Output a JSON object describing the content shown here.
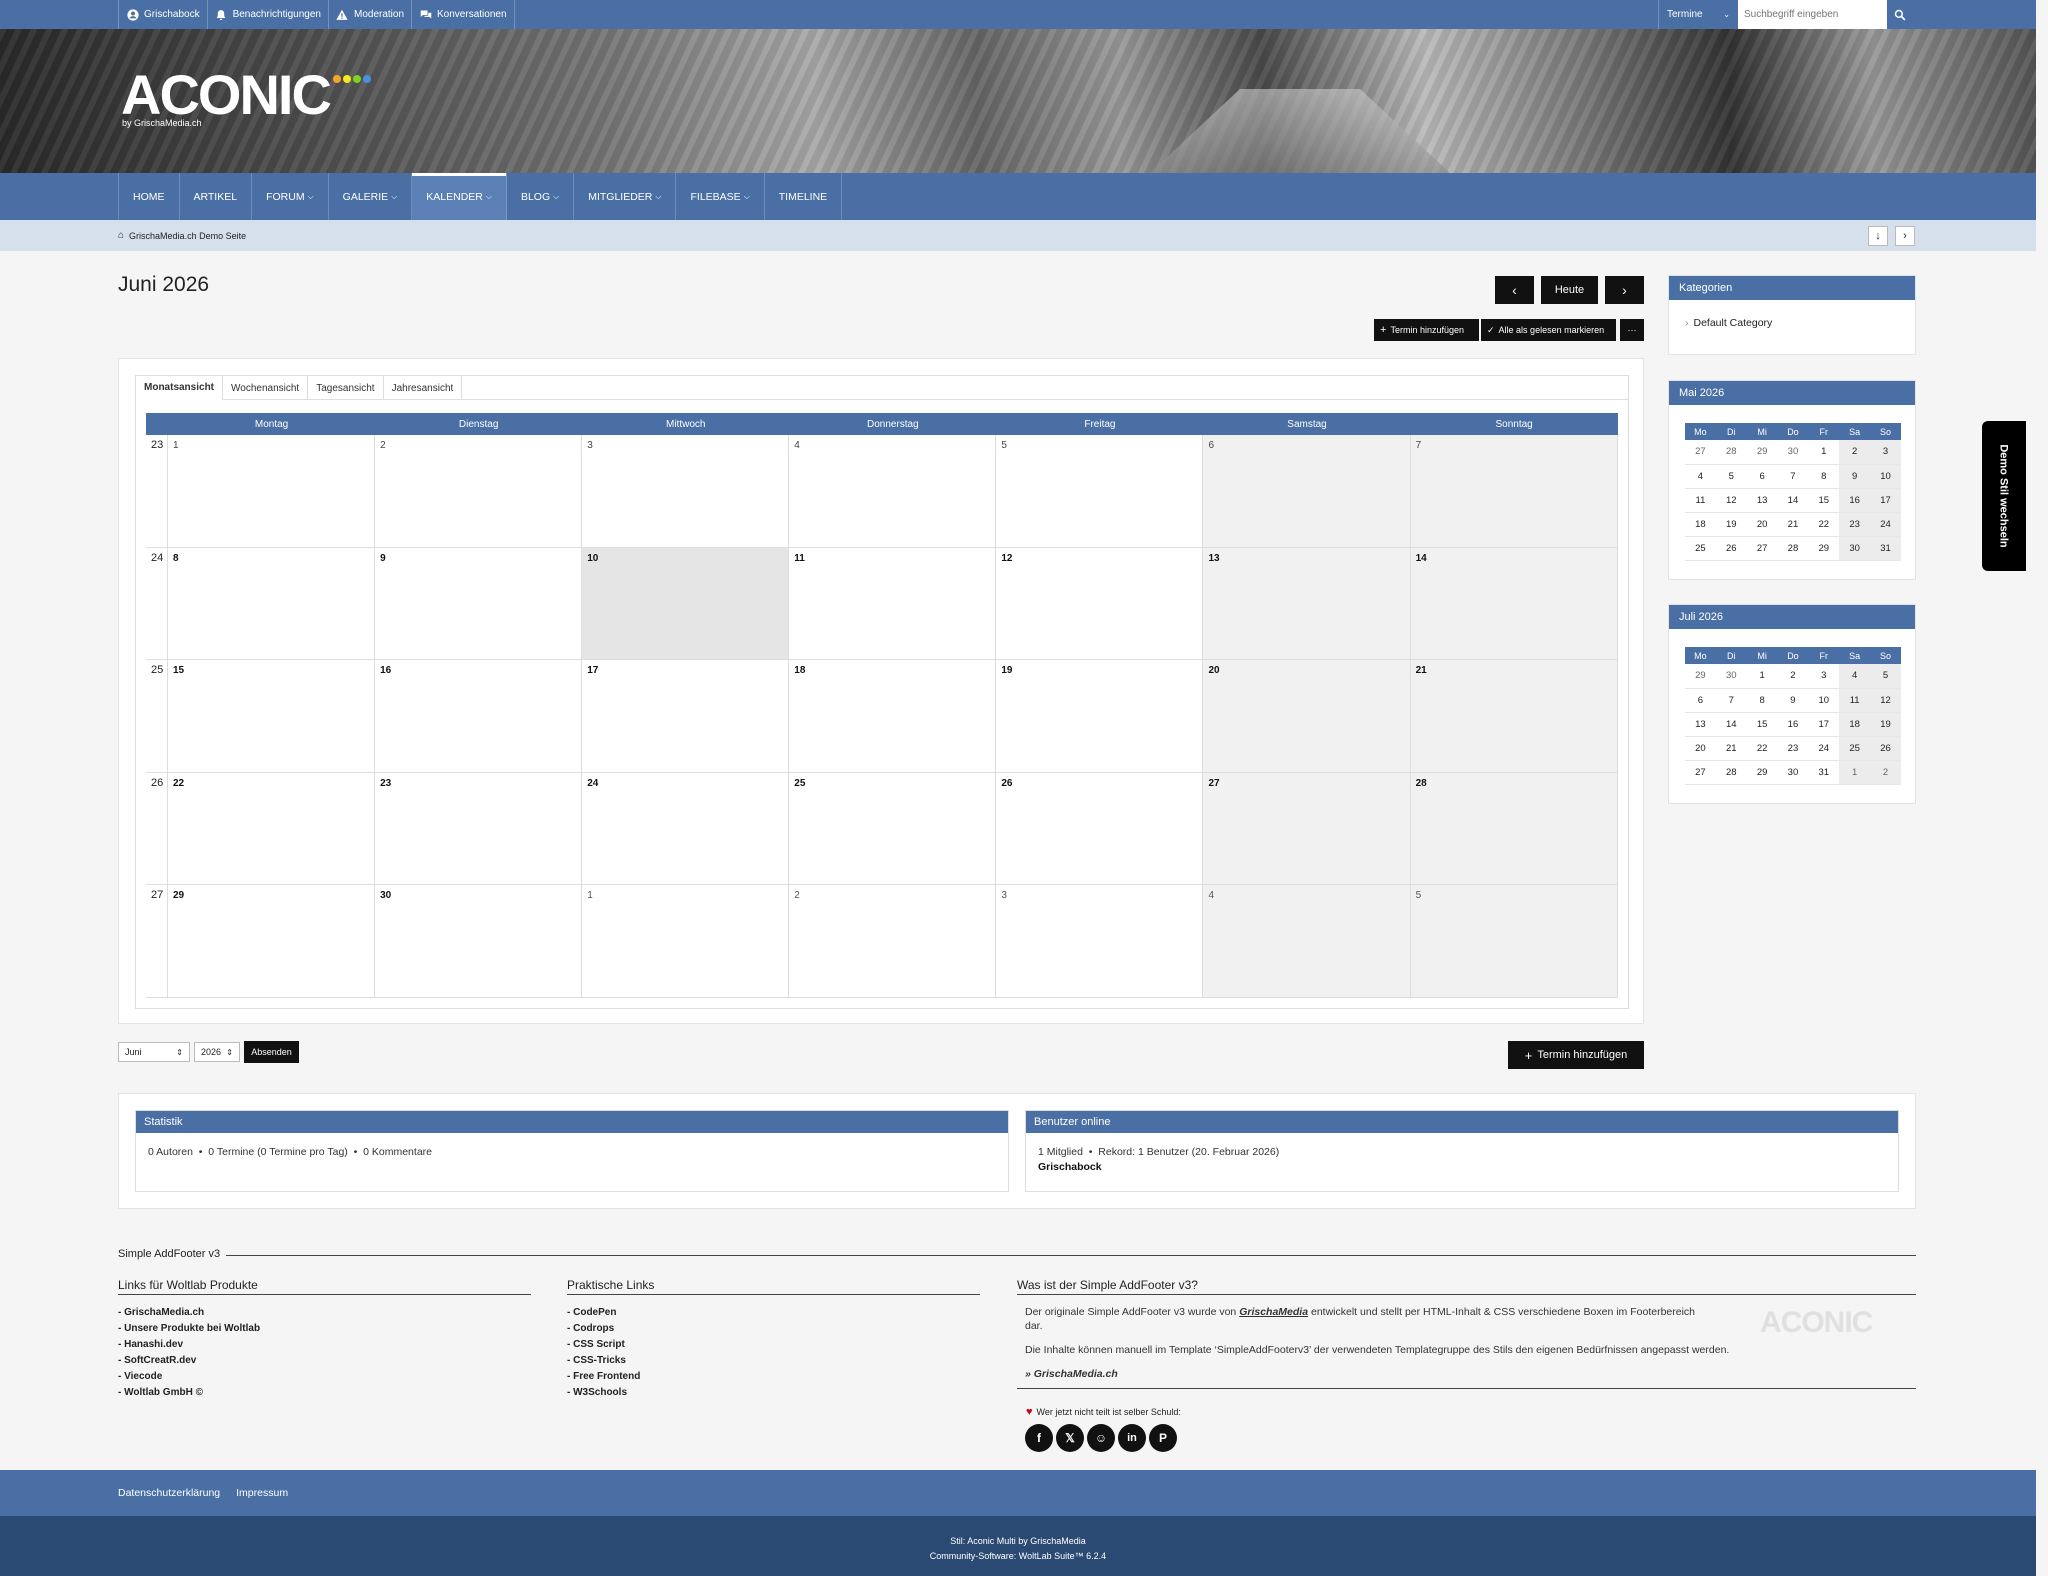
{
  "userbar": {
    "items": [
      {
        "label": "Grischabock",
        "icon": "user-circle-icon"
      },
      {
        "label": "Benachrichtigungen",
        "icon": "bell-icon"
      },
      {
        "label": "Moderation",
        "icon": "warning-icon"
      },
      {
        "label": "Konversationen",
        "icon": "chat-icon"
      }
    ],
    "search_scope": "Termine",
    "search_placeholder": "Suchbegriff eingeben"
  },
  "logo": {
    "text": "ACONIC",
    "subtitle": "by GrischaMedia.ch",
    "dot_colors": [
      "#f5a623",
      "#f8e71c",
      "#7ed321",
      "#4a90e2"
    ]
  },
  "nav": {
    "items": [
      {
        "label": "HOME",
        "dropdown": false
      },
      {
        "label": "ARTIKEL",
        "dropdown": false
      },
      {
        "label": "FORUM",
        "dropdown": true
      },
      {
        "label": "GALERIE",
        "dropdown": true
      },
      {
        "label": "KALENDER",
        "dropdown": true,
        "active": true
      },
      {
        "label": "BLOG",
        "dropdown": true
      },
      {
        "label": "MITGLIEDER",
        "dropdown": true
      },
      {
        "label": "FILEBASE",
        "dropdown": true
      },
      {
        "label": "TIMELINE",
        "dropdown": false
      }
    ]
  },
  "breadcrumb": {
    "label": "GrischaMedia.ch Demo Seite"
  },
  "page": {
    "title": "Juni 2026",
    "today_label": "Heute",
    "add_event_label": "Termin hinzufügen",
    "mark_read_label": "Alle als gelesen markieren",
    "more_label": "···"
  },
  "calendar": {
    "tabs": [
      "Monatsansicht",
      "Wochenansicht",
      "Tagesansicht",
      "Jahresansicht"
    ],
    "weekdays": [
      "Montag",
      "Dienstag",
      "Mittwoch",
      "Donnerstag",
      "Freitag",
      "Samstag",
      "Sonntag"
    ],
    "weeks": [
      {
        "kw": "23",
        "days": [
          "1",
          "2",
          "3",
          "4",
          "5",
          "6",
          "7"
        ]
      },
      {
        "kw": "24",
        "days": [
          "8",
          "9",
          "10",
          "11",
          "12",
          "13",
          "14"
        ]
      },
      {
        "kw": "25",
        "days": [
          "15",
          "16",
          "17",
          "18",
          "19",
          "20",
          "21"
        ]
      },
      {
        "kw": "26",
        "days": [
          "22",
          "23",
          "24",
          "25",
          "26",
          "27",
          "28"
        ]
      },
      {
        "kw": "27",
        "days": [
          "29",
          "30",
          "1",
          "2",
          "3",
          "4",
          "5"
        ]
      }
    ],
    "today": "10"
  },
  "month_select": {
    "month": "Juni",
    "year": "2026",
    "submit_label": "Absenden"
  },
  "sidebar": {
    "categories_title": "Kategorien",
    "categories": [
      "Default Category"
    ],
    "mini_weekdays": [
      "Mo",
      "Di",
      "Mi",
      "Do",
      "Fr",
      "Sa",
      "So"
    ],
    "mai": {
      "title": "Mai 2026",
      "rows": [
        [
          "27",
          "28",
          "29",
          "30",
          "1",
          "2",
          "3"
        ],
        [
          "4",
          "5",
          "6",
          "7",
          "8",
          "9",
          "10"
        ],
        [
          "11",
          "12",
          "13",
          "14",
          "15",
          "16",
          "17"
        ],
        [
          "18",
          "19",
          "20",
          "21",
          "22",
          "23",
          "24"
        ],
        [
          "25",
          "26",
          "27",
          "28",
          "29",
          "30",
          "31"
        ]
      ]
    },
    "juli": {
      "title": "Juli 2026",
      "rows": [
        [
          "29",
          "30",
          "1",
          "2",
          "3",
          "4",
          "5"
        ],
        [
          "6",
          "7",
          "8",
          "9",
          "10",
          "11",
          "12"
        ],
        [
          "13",
          "14",
          "15",
          "16",
          "17",
          "18",
          "19"
        ],
        [
          "20",
          "21",
          "22",
          "23",
          "24",
          "25",
          "26"
        ],
        [
          "27",
          "28",
          "29",
          "30",
          "31",
          "1",
          "2"
        ]
      ]
    }
  },
  "demo_tab": "Demo Stil wechseln",
  "stats": {
    "statistik_title": "Statistik",
    "statistik_text": "0 Autoren  •  0 Termine (0 Termine pro Tag)  •  0 Kommentare",
    "online_title": "Benutzer online",
    "online_text": "1 Mitglied  •  Rekord: 1 Benutzer (20. Februar 2026)",
    "online_user": "Grischabock"
  },
  "addfooter": {
    "title": "Simple AddFooter v3",
    "col1_title": "Links für Woltlab Produkte",
    "col1_links": [
      "GrischaMedia.ch",
      "Unsere Produkte bei Woltlab",
      "Hanashi.dev",
      "SoftCreatR.dev",
      "Viecode",
      "Woltlab GmbH ©"
    ],
    "col2_title": "Praktische Links",
    "col2_links": [
      "CodePen",
      "Codrops",
      "CSS Script",
      "CSS-Tricks",
      "Free Frontend",
      "W3Schools"
    ],
    "col3_title": "Was ist der Simple AddFooter v3?",
    "col3_p1a": "Der originale Simple AddFooter v3 wurde von ",
    "col3_p1b": "GrischaMedia",
    "col3_p1c": " entwickelt und stellt per HTML-Inhalt & CSS verschiedene Boxen im Footerbereich dar.",
    "col3_p2": "Die Inhalte können manuell im Template ‘SimpleAddFooterv3’ der verwendeten Templategruppe des Stils den eigenen Bedürfnissen angepasst werden.",
    "col3_sig": "» GrischaMedia.ch",
    "share_label": "Wer jetzt nicht teilt ist selber Schuld:",
    "social_icons": [
      "facebook-icon",
      "x-icon",
      "reddit-icon",
      "linkedin-icon",
      "pinterest-icon"
    ]
  },
  "footer": {
    "links": [
      "Datenschutzerklärung",
      "Impressum"
    ],
    "line1": "Stil: Aconic Multi by GrischaMedia",
    "line2": "Community-Software: WoltLab Suite™ 6.2.4"
  }
}
